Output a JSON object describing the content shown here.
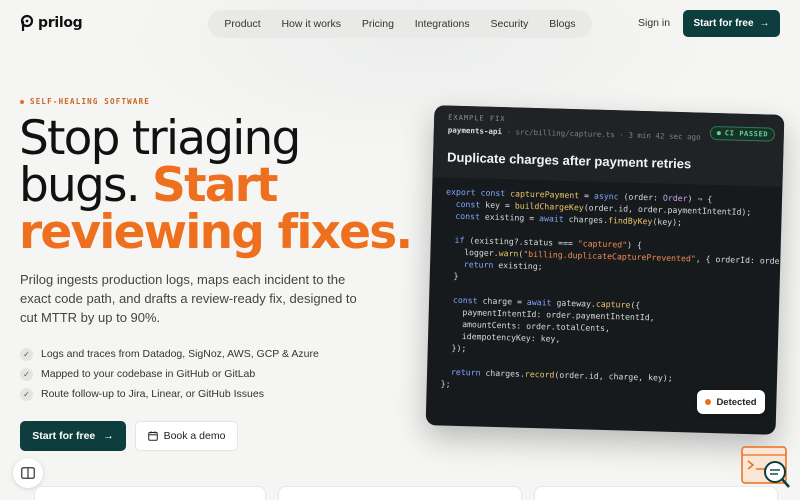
{
  "brand": {
    "name": "prilog"
  },
  "nav": {
    "items": [
      "Product",
      "How it works",
      "Pricing",
      "Integrations",
      "Security",
      "Blogs"
    ],
    "sign_in": "Sign in",
    "cta": "Start for free"
  },
  "hero": {
    "eyebrow": "SELF-HEALING SOFTWARE",
    "headline_line1": "Stop triaging",
    "headline_line2_plain": "bugs.",
    "headline_line2_accent": "Start",
    "headline_line3_accent": "reviewing fixes.",
    "lede": "Prilog ingests production logs, maps each incident to the exact code path, and drafts a review-ready fix, designed to cut MTTR by up to 90%.",
    "checks": [
      "Logs and traces from Datadog, SigNoz, AWS, GCP & Azure",
      "Mapped to your codebase in GitHub or GitLab",
      "Route follow-up to Jira, Linear, or GitHub Issues"
    ],
    "primary_cta": "Start for free",
    "secondary_cta": "Book a demo"
  },
  "example": {
    "label": "EXAMPLE FIX",
    "repo": "payments-api",
    "path": "src/billing/capture.ts",
    "age": "3 min 42 sec ago",
    "badge": "CI PASSED",
    "title": "Duplicate charges after payment retries",
    "status_chip": "Detected"
  },
  "colors": {
    "accent": "#ee6f1e",
    "brand_dark": "#0d3d3d",
    "ci_green": "#5fd39a"
  }
}
